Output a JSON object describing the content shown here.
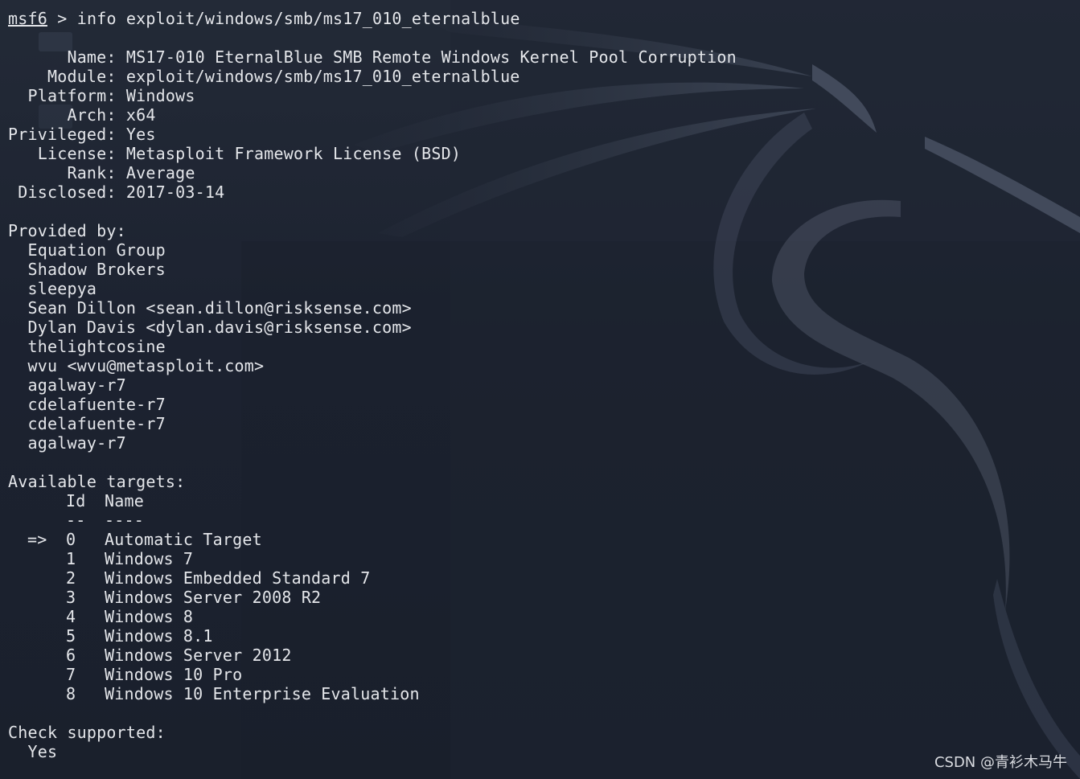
{
  "prompt": {
    "name": "msf6",
    "symbol": ">",
    "command": "info exploit/windows/smb/ms17_010_eternalblue"
  },
  "module_info": [
    {
      "label": "Name",
      "value": "MS17-010 EternalBlue SMB Remote Windows Kernel Pool Corruption"
    },
    {
      "label": "Module",
      "value": "exploit/windows/smb/ms17_010_eternalblue"
    },
    {
      "label": "Platform",
      "value": "Windows"
    },
    {
      "label": "Arch",
      "value": "x64"
    },
    {
      "label": "Privileged",
      "value": "Yes"
    },
    {
      "label": "License",
      "value": "Metasploit Framework License (BSD)"
    },
    {
      "label": "Rank",
      "value": "Average"
    },
    {
      "label": "Disclosed",
      "value": "2017-03-14"
    }
  ],
  "provided_by": {
    "heading": "Provided by:",
    "authors": [
      "Equation Group",
      "Shadow Brokers",
      "sleepya",
      "Sean Dillon <sean.dillon@risksense.com>",
      "Dylan Davis <dylan.davis@risksense.com>",
      "thelightcosine",
      "wvu <wvu@metasploit.com>",
      "agalway-r7",
      "cdelafuente-r7",
      "cdelafuente-r7",
      "agalway-r7"
    ]
  },
  "targets": {
    "heading": "Available targets:",
    "columns": [
      "Id",
      "Name"
    ],
    "separators": [
      "--",
      "----"
    ],
    "selected_marker": "=>",
    "rows": [
      {
        "id": "0",
        "name": "Automatic Target",
        "selected": true
      },
      {
        "id": "1",
        "name": "Windows 7",
        "selected": false
      },
      {
        "id": "2",
        "name": "Windows Embedded Standard 7",
        "selected": false
      },
      {
        "id": "3",
        "name": "Windows Server 2008 R2",
        "selected": false
      },
      {
        "id": "4",
        "name": "Windows 8",
        "selected": false
      },
      {
        "id": "5",
        "name": "Windows 8.1",
        "selected": false
      },
      {
        "id": "6",
        "name": "Windows Server 2012",
        "selected": false
      },
      {
        "id": "7",
        "name": "Windows 10 Pro",
        "selected": false
      },
      {
        "id": "8",
        "name": "Windows 10 Enterprise Evaluation",
        "selected": false
      }
    ]
  },
  "check": {
    "heading": "Check supported:",
    "value": "Yes"
  },
  "watermark": "CSDN @青衫木马牛",
  "colors": {
    "background": "#1d2330",
    "text": "#e4e6ea",
    "dragon": "#3a4252"
  }
}
